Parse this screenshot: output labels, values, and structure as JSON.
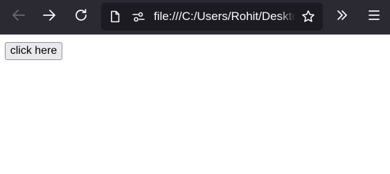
{
  "browser": {
    "address": "file:///C:/Users/Rohit/Desktop",
    "icons": {
      "back": "arrow-left-icon",
      "forward": "arrow-right-icon",
      "reload": "reload-icon",
      "page": "page-icon",
      "permissions": "permissions-icon",
      "bookmark": "star-icon",
      "overflow": "chevrons-right-icon",
      "menu": "hamburger-icon"
    },
    "colors": {
      "toolbar": "#2b2a33",
      "urlbar": "#1c1b22",
      "icon": "#fbfbfe",
      "icon_disabled": "#6b6a72"
    }
  },
  "page": {
    "button_label": "click here"
  }
}
